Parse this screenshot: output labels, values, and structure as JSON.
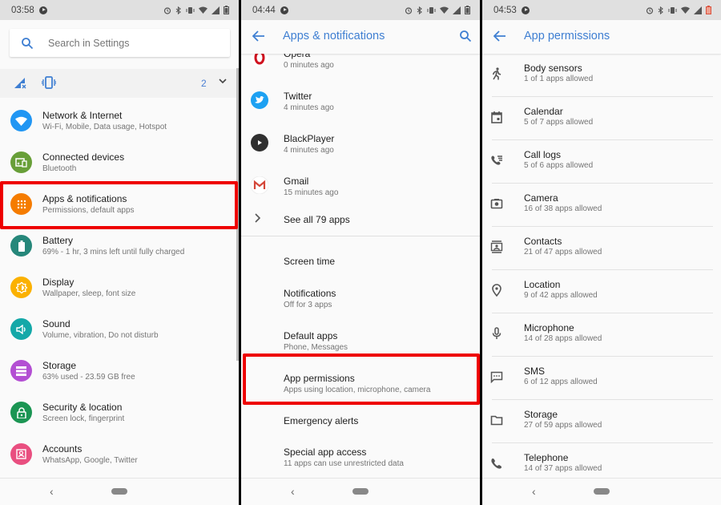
{
  "screens": [
    {
      "status": {
        "time": "03:58"
      },
      "search": {
        "placeholder": "Search in Settings"
      },
      "conditionals": {
        "count": "2"
      },
      "items": [
        {
          "title": "Network & Internet",
          "subtitle": "Wi-Fi, Mobile, Data usage, Hotspot",
          "icon": "wifi-icon",
          "color": "#2196f3"
        },
        {
          "title": "Connected devices",
          "subtitle": "Bluetooth",
          "icon": "devices-icon",
          "color": "#689f38"
        },
        {
          "title": "Apps & notifications",
          "subtitle": "Permissions, default apps",
          "icon": "apps-grid-icon",
          "color": "#f57c00"
        },
        {
          "title": "Battery",
          "subtitle": "69% - 1 hr, 3 mins left until fully charged",
          "icon": "battery-icon",
          "color": "#26877a"
        },
        {
          "title": "Display",
          "subtitle": "Wallpaper, sleep, font size",
          "icon": "brightness-icon",
          "color": "#fbb100"
        },
        {
          "title": "Sound",
          "subtitle": "Volume, vibration, Do not disturb",
          "icon": "volume-icon",
          "color": "#14a8a8"
        },
        {
          "title": "Storage",
          "subtitle": "63% used - 23.59 GB free",
          "icon": "storage-icon",
          "color": "#b34fd3"
        },
        {
          "title": "Security & location",
          "subtitle": "Screen lock, fingerprint",
          "icon": "lock-icon",
          "color": "#1b9553"
        },
        {
          "title": "Accounts",
          "subtitle": "WhatsApp, Google, Twitter",
          "icon": "account-icon",
          "color": "#e94f80"
        }
      ]
    },
    {
      "status": {
        "time": "04:44"
      },
      "title": "Apps & notifications",
      "recent_apps": [
        {
          "title": "Opera",
          "subtitle": "0 minutes ago",
          "icon": "opera-icon"
        },
        {
          "title": "Twitter",
          "subtitle": "4 minutes ago",
          "icon": "twitter-icon"
        },
        {
          "title": "BlackPlayer",
          "subtitle": "4 minutes ago",
          "icon": "blackplayer-icon"
        },
        {
          "title": "Gmail",
          "subtitle": "15 minutes ago",
          "icon": "gmail-icon"
        }
      ],
      "see_all": "See all 79 apps",
      "items": [
        {
          "title": "Screen time",
          "subtitle": ""
        },
        {
          "title": "Notifications",
          "subtitle": "Off for 3 apps"
        },
        {
          "title": "Default apps",
          "subtitle": "Phone, Messages"
        },
        {
          "title": "App permissions",
          "subtitle": "Apps using location, microphone, camera"
        },
        {
          "title": "Emergency alerts",
          "subtitle": ""
        },
        {
          "title": "Special app access",
          "subtitle": "11 apps can use unrestricted data"
        }
      ]
    },
    {
      "status": {
        "time": "04:53"
      },
      "title": "App permissions",
      "items": [
        {
          "title": "Body sensors",
          "subtitle": "1 of 1 apps allowed",
          "icon": "body-sensors-icon"
        },
        {
          "title": "Calendar",
          "subtitle": "5 of 7 apps allowed",
          "icon": "calendar-icon"
        },
        {
          "title": "Call logs",
          "subtitle": "5 of 6 apps allowed",
          "icon": "call-log-icon"
        },
        {
          "title": "Camera",
          "subtitle": "16 of 38 apps allowed",
          "icon": "camera-icon"
        },
        {
          "title": "Contacts",
          "subtitle": "21 of 47 apps allowed",
          "icon": "contacts-icon"
        },
        {
          "title": "Location",
          "subtitle": "9 of 42 apps allowed",
          "icon": "location-icon"
        },
        {
          "title": "Microphone",
          "subtitle": "14 of 28 apps allowed",
          "icon": "microphone-icon"
        },
        {
          "title": "SMS",
          "subtitle": "6 of 12 apps allowed",
          "icon": "sms-icon"
        },
        {
          "title": "Storage",
          "subtitle": "27 of 59 apps allowed",
          "icon": "folder-icon"
        },
        {
          "title": "Telephone",
          "subtitle": "14 of 37 apps allowed",
          "icon": "phone-icon"
        }
      ]
    }
  ],
  "colors": {
    "accent": "#3f7fd2",
    "highlight": "#ee0000"
  }
}
